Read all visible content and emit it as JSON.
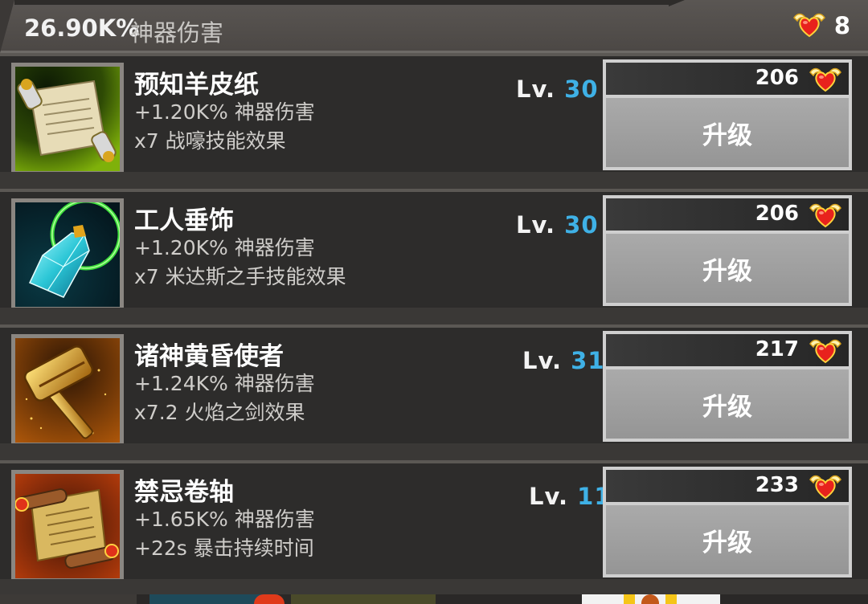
{
  "header": {
    "total_value": "26.90K%",
    "total_label": "神器伤害",
    "heart_count": "8"
  },
  "artifacts": [
    {
      "name": "预知羊皮纸",
      "stat1": "+1.20K% 神器伤害",
      "stat2": "x7 战嚎技能效果",
      "level_prefix": "Lv.",
      "level": "30",
      "cost": "206",
      "button": "升级",
      "icon": "parchment-scroll-icon"
    },
    {
      "name": "工人垂饰",
      "stat1": "+1.20K% 神器伤害",
      "stat2": "x7 米达斯之手技能效果",
      "level_prefix": "Lv.",
      "level": "30",
      "cost": "206",
      "button": "升级",
      "icon": "crystal-pendant-icon"
    },
    {
      "name": "诸神黄昏使者",
      "stat1": "+1.24K% 神器伤害",
      "stat2": "x7.2 火焰之剑效果",
      "level_prefix": "Lv.",
      "level": "31",
      "cost": "217",
      "button": "升级",
      "icon": "golden-hammer-icon"
    },
    {
      "name": "禁忌卷轴",
      "stat1": "+1.65K% 神器伤害",
      "stat2": "+22s 暴击持续时间",
      "level_prefix": "Lv.",
      "level": "11",
      "cost": "233",
      "button": "升级",
      "icon": "forbidden-scroll-icon"
    }
  ],
  "colors": {
    "level_number": "#3fb1e6",
    "row_bg": "#2d2c2b",
    "button_bg": "#a3a3a3"
  }
}
